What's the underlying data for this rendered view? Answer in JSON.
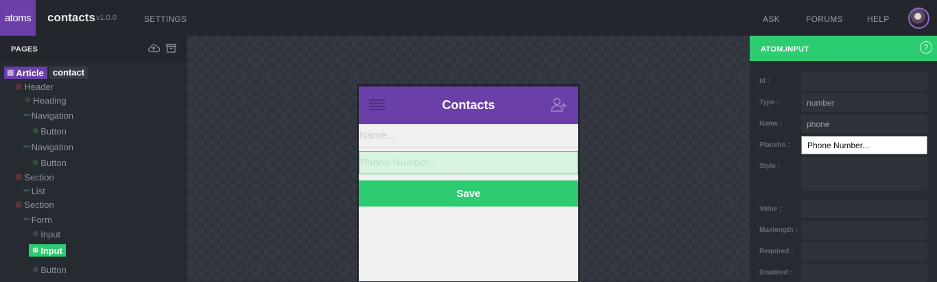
{
  "topbar": {
    "logo": "atoms",
    "app_title": "contacts",
    "app_version": "v1.0.0",
    "nav": {
      "settings": "SETTINGS",
      "ask": "ASK",
      "forums": "FORUMS",
      "help": "HELP"
    }
  },
  "sidebar": {
    "title": "PAGES",
    "icons": [
      "cloud-upload-icon",
      "archive-icon"
    ],
    "tree": {
      "article": "Article",
      "contact": "contact",
      "header": "Header",
      "heading": "Heading",
      "navigation_1": "Navigation",
      "button_1": "Button",
      "navigation_2": "Navigation",
      "button_2": "Button",
      "section_1": "Section",
      "list": "List",
      "section_2": "Section",
      "form": "Form",
      "input_1": "Input",
      "input_2": "Input",
      "button_3": "Button"
    }
  },
  "preview": {
    "title": "Contacts",
    "name_placeholder": "Name...",
    "phone_placeholder": "Phone Number...",
    "save_label": "Save",
    "colors": {
      "header": "#6b3fa8",
      "accent": "#2ecc71"
    }
  },
  "panel": {
    "title": "ATOM.INPUT",
    "labels": {
      "id": "Id :",
      "type": "Type :",
      "name": "Name :",
      "placeholder": "Placeho :",
      "style": "Style :",
      "value": "Value :",
      "maxlength": "Maxlength :",
      "required": "Required :",
      "disabled": "Disabled :"
    },
    "values": {
      "id": "",
      "type": "number",
      "name": "phone",
      "placeholder": "Phone Number...",
      "style": "",
      "value": "",
      "maxlength": "",
      "required": "",
      "disabled": ""
    }
  }
}
